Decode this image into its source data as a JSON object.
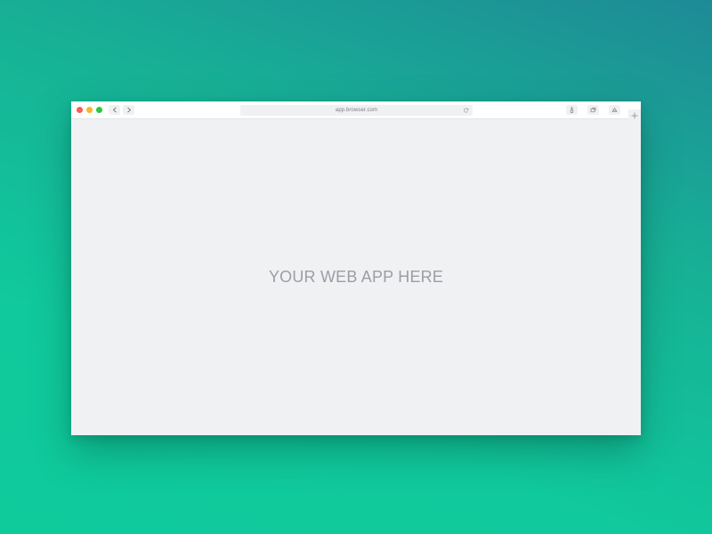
{
  "window": {
    "url": "app.browser.com",
    "content_text": "YOUR WEB APP HERE"
  },
  "controls": {
    "close_color": "#fb5b55",
    "minimize_color": "#f8b62c",
    "maximize_color": "#2bc840"
  },
  "icons": {
    "back": "chevron-left-icon",
    "forward": "chevron-right-icon",
    "reload": "reload-icon",
    "share": "share-icon",
    "tabs": "tabs-icon",
    "cloud": "cloud-icon",
    "new_tab": "plus-icon"
  },
  "colors": {
    "background_top": "#1e8a96",
    "background_bottom": "#0fcb9c",
    "content_background": "#f0f1f3"
  }
}
